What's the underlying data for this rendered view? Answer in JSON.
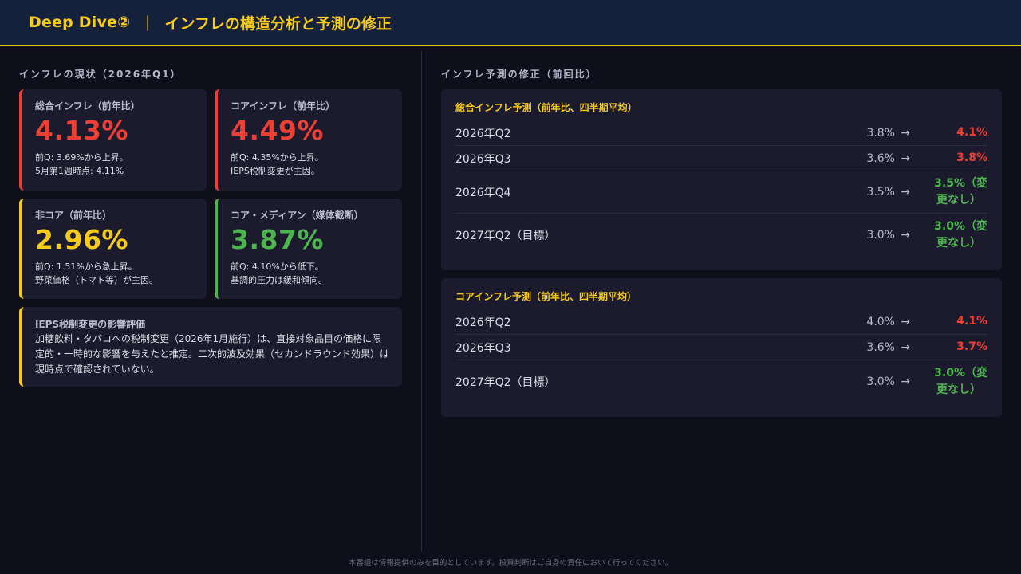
{
  "header": {
    "title": "Deep Dive②",
    "separator": "｜",
    "subtitle": "インフレの構造分析と予測の修正"
  },
  "left": {
    "section_label": "インフレの現状（2026年Q1）",
    "cards": [
      {
        "title": "総合インフレ（前年比）",
        "value": "4.13%",
        "note1": "前Q: 3.69%から上昇。",
        "note2": "5月第1週時点: 4.11%",
        "color": "#ec4036"
      },
      {
        "title": "コアインフレ（前年比）",
        "value": "4.49%",
        "note1": "前Q: 4.35%から上昇。",
        "note2": "IEPS税制変更が主因。",
        "color": "#ec4036"
      },
      {
        "title": "非コア（前年比）",
        "value": "2.96%",
        "note1": "前Q: 1.51%から急上昇。",
        "note2": "野菜価格（トマト等）が主因。",
        "color": "#f6cb1a"
      },
      {
        "title": "コア・メディアン（媒体截断）",
        "value": "3.87%",
        "note1": "前Q: 4.10%から低下。",
        "note2": "基調的圧力は緩和傾向。",
        "color": "#4cb54e"
      }
    ],
    "assessment": {
      "title": "IEPS税制変更の影響評価",
      "body": "加糖飲料・タバコへの税制変更（2026年1月施行）は、直接対象品目の価格に限定的・一時的な影響を与えたと推定。二次的波及効果（セカンドラウンド効果）は現時点で確認されていない。"
    }
  },
  "right": {
    "section_label": "インフレ予測の修正（前回比）",
    "arrow": "→",
    "headline": {
      "title": "総合インフレ予測（前年比、四半期平均）",
      "rows": [
        {
          "label": "2026年Q2",
          "prev": "3.8%",
          "new1": "4.1%",
          "new2": "",
          "color": "#ec4036"
        },
        {
          "label": "2026年Q3",
          "prev": "3.6%",
          "new1": "3.8%",
          "new2": "",
          "color": "#ec4036"
        },
        {
          "label": "2026年Q4",
          "prev": "3.5%",
          "new1": "3.5%（変",
          "new2": "更なし）",
          "color": "#4cb54e"
        },
        {
          "label": "2027年Q2（目標）",
          "prev": "3.0%",
          "new1": "3.0%（変",
          "new2": "更なし）",
          "color": "#4cb54e"
        }
      ]
    },
    "core": {
      "title": "コアインフレ予測（前年比、四半期平均）",
      "rows": [
        {
          "label": "2026年Q2",
          "prev": "4.0%",
          "new1": "4.1%",
          "new2": "",
          "color": "#ec4036"
        },
        {
          "label": "2026年Q3",
          "prev": "3.6%",
          "new1": "3.7%",
          "new2": "",
          "color": "#ec4036"
        },
        {
          "label": "2027年Q2（目標）",
          "prev": "3.0%",
          "new1": "3.0%（変",
          "new2": "更なし）",
          "color": "#4cb54e"
        }
      ]
    }
  },
  "footer": "本番組は情報提供のみを目的としています。投資判断はご自身の責任において行ってください。"
}
